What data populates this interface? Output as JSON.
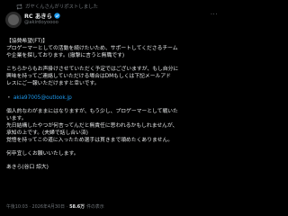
{
  "repost_text": "ガヤくんさんがリポストしました",
  "author": {
    "name": "RC あきら",
    "handle": "@akirdoyoooo"
  },
  "more_label": "···",
  "post": {
    "heading": "【協賛希望(FT)】",
    "line1": "プロゲーマーとしての活動を続けたいため、サポートしてくださるチーム",
    "line2": "や企業を探しております。(撤撃に言うと無職です)",
    "line3": "こちらからもお声掛けさせていただく予定ではございますが、もし自分に",
    "line4": "興味を持ってご連絡していただける場合はDMもしくは下記メールアド",
    "line5": "レスにご一報いただけますと幸いです。",
    "email_bullet": "・",
    "email": "akia97005@outlook.jp",
    "line6": "個人的なわがままにはなりますが、もう少し、プロゲーマーとして戦いた",
    "line7": "います。",
    "line8": "先日結構したやつが何言ってんだと無責任に思われるかもしれませんが、",
    "line9": "承知の上です。(夫婦で話し合い済)",
    "line10": "覚悟を持ってこの道に入ったため選手は貫きまで頑めたくありません。",
    "line11": "何卒宜しくお願いいたします。",
    "signature": "あきら(谷口 諒大)"
  },
  "meta": {
    "time": "午後10:03 · 2026年4月30日 ·",
    "views_count": "58.6万",
    "views_label": "件の表示"
  }
}
